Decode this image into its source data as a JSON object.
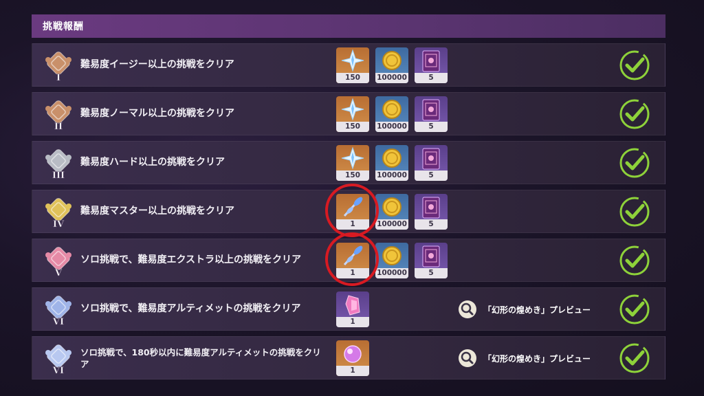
{
  "header": {
    "title": "挑戦報酬"
  },
  "rows": [
    {
      "text": "難易度イージー以上の挑戦をクリア",
      "badge": "I",
      "badge_color": "#c9906a",
      "items": [
        {
          "kind": "primogem-icon",
          "bg": "orange",
          "count": "150"
        },
        {
          "kind": "mora-icon",
          "bg": "blue",
          "count": "100000"
        },
        {
          "kind": "book-icon",
          "bg": "purple",
          "count": "5"
        }
      ],
      "circled": false,
      "preview": null
    },
    {
      "text": "難易度ノーマル以上の挑戦をクリア",
      "badge": "II",
      "badge_color": "#c9906a",
      "items": [
        {
          "kind": "primogem-icon",
          "bg": "orange",
          "count": "150"
        },
        {
          "kind": "mora-icon",
          "bg": "blue",
          "count": "100000"
        },
        {
          "kind": "book-icon",
          "bg": "purple",
          "count": "5"
        }
      ],
      "circled": false,
      "preview": null
    },
    {
      "text": "難易度ハード以上の挑戦をクリア",
      "badge": "III",
      "badge_color": "#b8bcc4",
      "items": [
        {
          "kind": "primogem-icon",
          "bg": "orange",
          "count": "150"
        },
        {
          "kind": "mora-icon",
          "bg": "blue",
          "count": "100000"
        },
        {
          "kind": "book-icon",
          "bg": "purple",
          "count": "5"
        }
      ],
      "circled": false,
      "preview": null
    },
    {
      "text": "難易度マスター以上の挑戦をクリア",
      "badge": "IV",
      "badge_color": "#e0c25a",
      "items": [
        {
          "kind": "flower-icon",
          "bg": "orange",
          "count": "1"
        },
        {
          "kind": "mora-icon",
          "bg": "blue",
          "count": "100000"
        },
        {
          "kind": "book-icon",
          "bg": "purple",
          "count": "5"
        }
      ],
      "circled": true,
      "preview": null
    },
    {
      "text": "ソロ挑戦で、難易度エクストラ以上の挑戦をクリア",
      "badge": "V",
      "badge_color": "#e68aa6",
      "items": [
        {
          "kind": "flower-icon",
          "bg": "orange",
          "count": "1"
        },
        {
          "kind": "mora-icon",
          "bg": "blue",
          "count": "100000"
        },
        {
          "kind": "book-icon",
          "bg": "purple",
          "count": "5"
        }
      ],
      "circled": true,
      "preview": null
    },
    {
      "text": "ソロ挑戦で、難易度アルティメットの挑戦をクリア",
      "badge": "VI",
      "badge_color": "#9fb4e8",
      "items": [
        {
          "kind": "crystal-icon",
          "bg": "purple",
          "count": "1"
        }
      ],
      "circled": false,
      "preview": "「幻形の煌めき」プレビュー"
    },
    {
      "text": "ソロ挑戦で、180秒以内に難易度アルティメットの挑戦をクリア",
      "badge": "VI",
      "badge_color": "#b8c8f0",
      "items": [
        {
          "kind": "orb-icon",
          "bg": "orange",
          "count": "1"
        }
      ],
      "circled": false,
      "preview": "「幻形の煌めき」プレビュー"
    }
  ],
  "colors": {
    "check": "#8ed23a",
    "circle": "#d81a22"
  }
}
